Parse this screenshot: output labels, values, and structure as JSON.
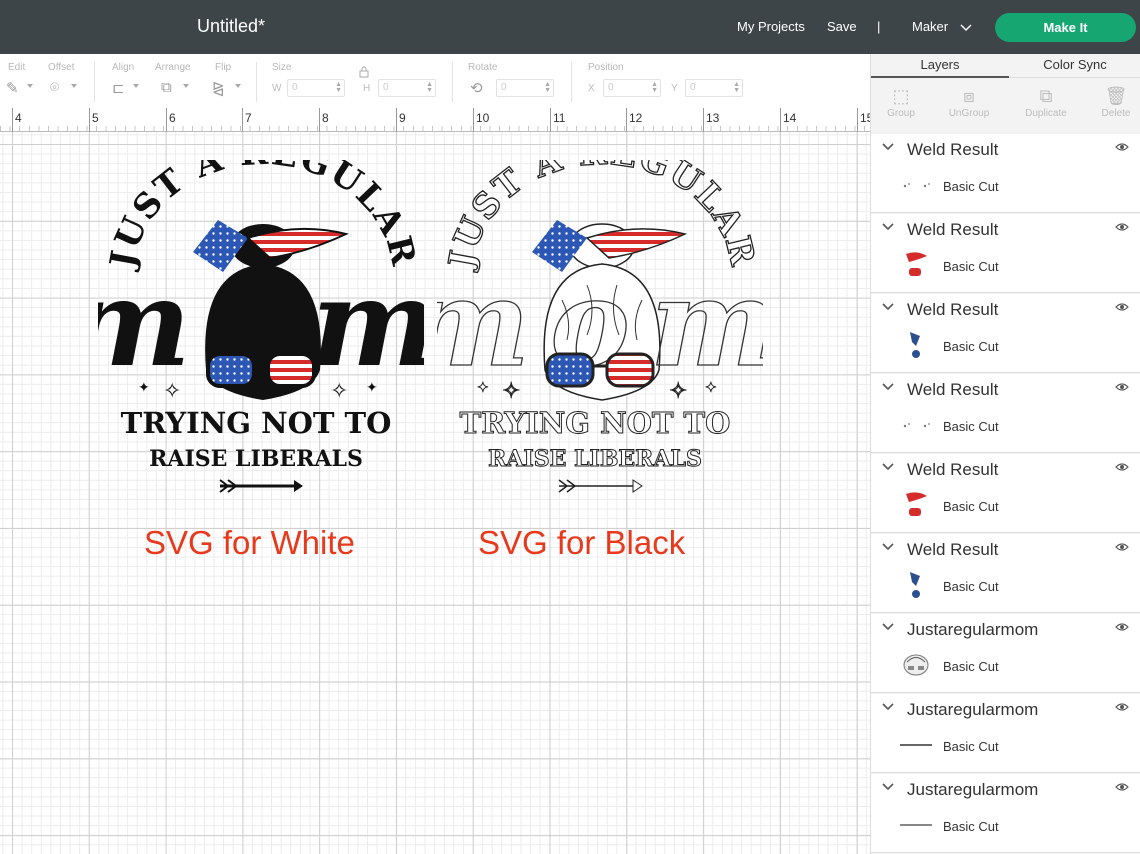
{
  "header": {
    "title": "Untitled*",
    "my_projects": "My Projects",
    "save": "Save",
    "separator": "|",
    "machine": "Maker",
    "make_it": "Make It",
    "make_it_color": "#16a671"
  },
  "toolbar": {
    "edit": "Edit",
    "offset": "Offset",
    "align": "Align",
    "arrange": "Arrange",
    "flip": "Flip",
    "size": "Size",
    "w": "W",
    "w_value": "0",
    "h": "H",
    "h_value": "0",
    "rotate": "Rotate",
    "rotate_value": "0",
    "position": "Position",
    "x": "X",
    "x_value": "0",
    "y": "Y",
    "y_value": "0"
  },
  "ruler": {
    "numbers": [
      "4",
      "5",
      "6",
      "7",
      "8",
      "9",
      "10",
      "11",
      "12",
      "13",
      "14",
      "15"
    ]
  },
  "canvas": {
    "design_text": {
      "top": "JUST A REGULAR",
      "mom": "mom",
      "line1": "TRYING NOT TO",
      "line2": "RAISE LIBERALS"
    },
    "caption_white": "SVG for White",
    "caption_black": "SVG for Black",
    "caption_color": "#e8391d"
  },
  "panel": {
    "tabs": {
      "layers": "Layers",
      "color_sync": "Color Sync"
    },
    "actions": {
      "group": "Group",
      "ungroup": "UnGroup",
      "duplicate": "Duplicate",
      "delete": "Delete"
    },
    "layers": [
      {
        "name": "Weld Result",
        "sub": "Basic Cut",
        "thumb": "dots"
      },
      {
        "name": "Weld Result",
        "sub": "Basic Cut",
        "thumb": "red"
      },
      {
        "name": "Weld Result",
        "sub": "Basic Cut",
        "thumb": "blue"
      },
      {
        "name": "Weld Result",
        "sub": "Basic Cut",
        "thumb": "dots"
      },
      {
        "name": "Weld Result",
        "sub": "Basic Cut",
        "thumb": "red"
      },
      {
        "name": "Weld Result",
        "sub": "Basic Cut",
        "thumb": "blue"
      },
      {
        "name": "Justaregularmom",
        "sub": "Basic Cut",
        "thumb": "face"
      },
      {
        "name": "Justaregularmom",
        "sub": "Basic Cut",
        "thumb": "text1"
      },
      {
        "name": "Justaregularmom",
        "sub": "Basic Cut",
        "thumb": "text2"
      }
    ]
  }
}
